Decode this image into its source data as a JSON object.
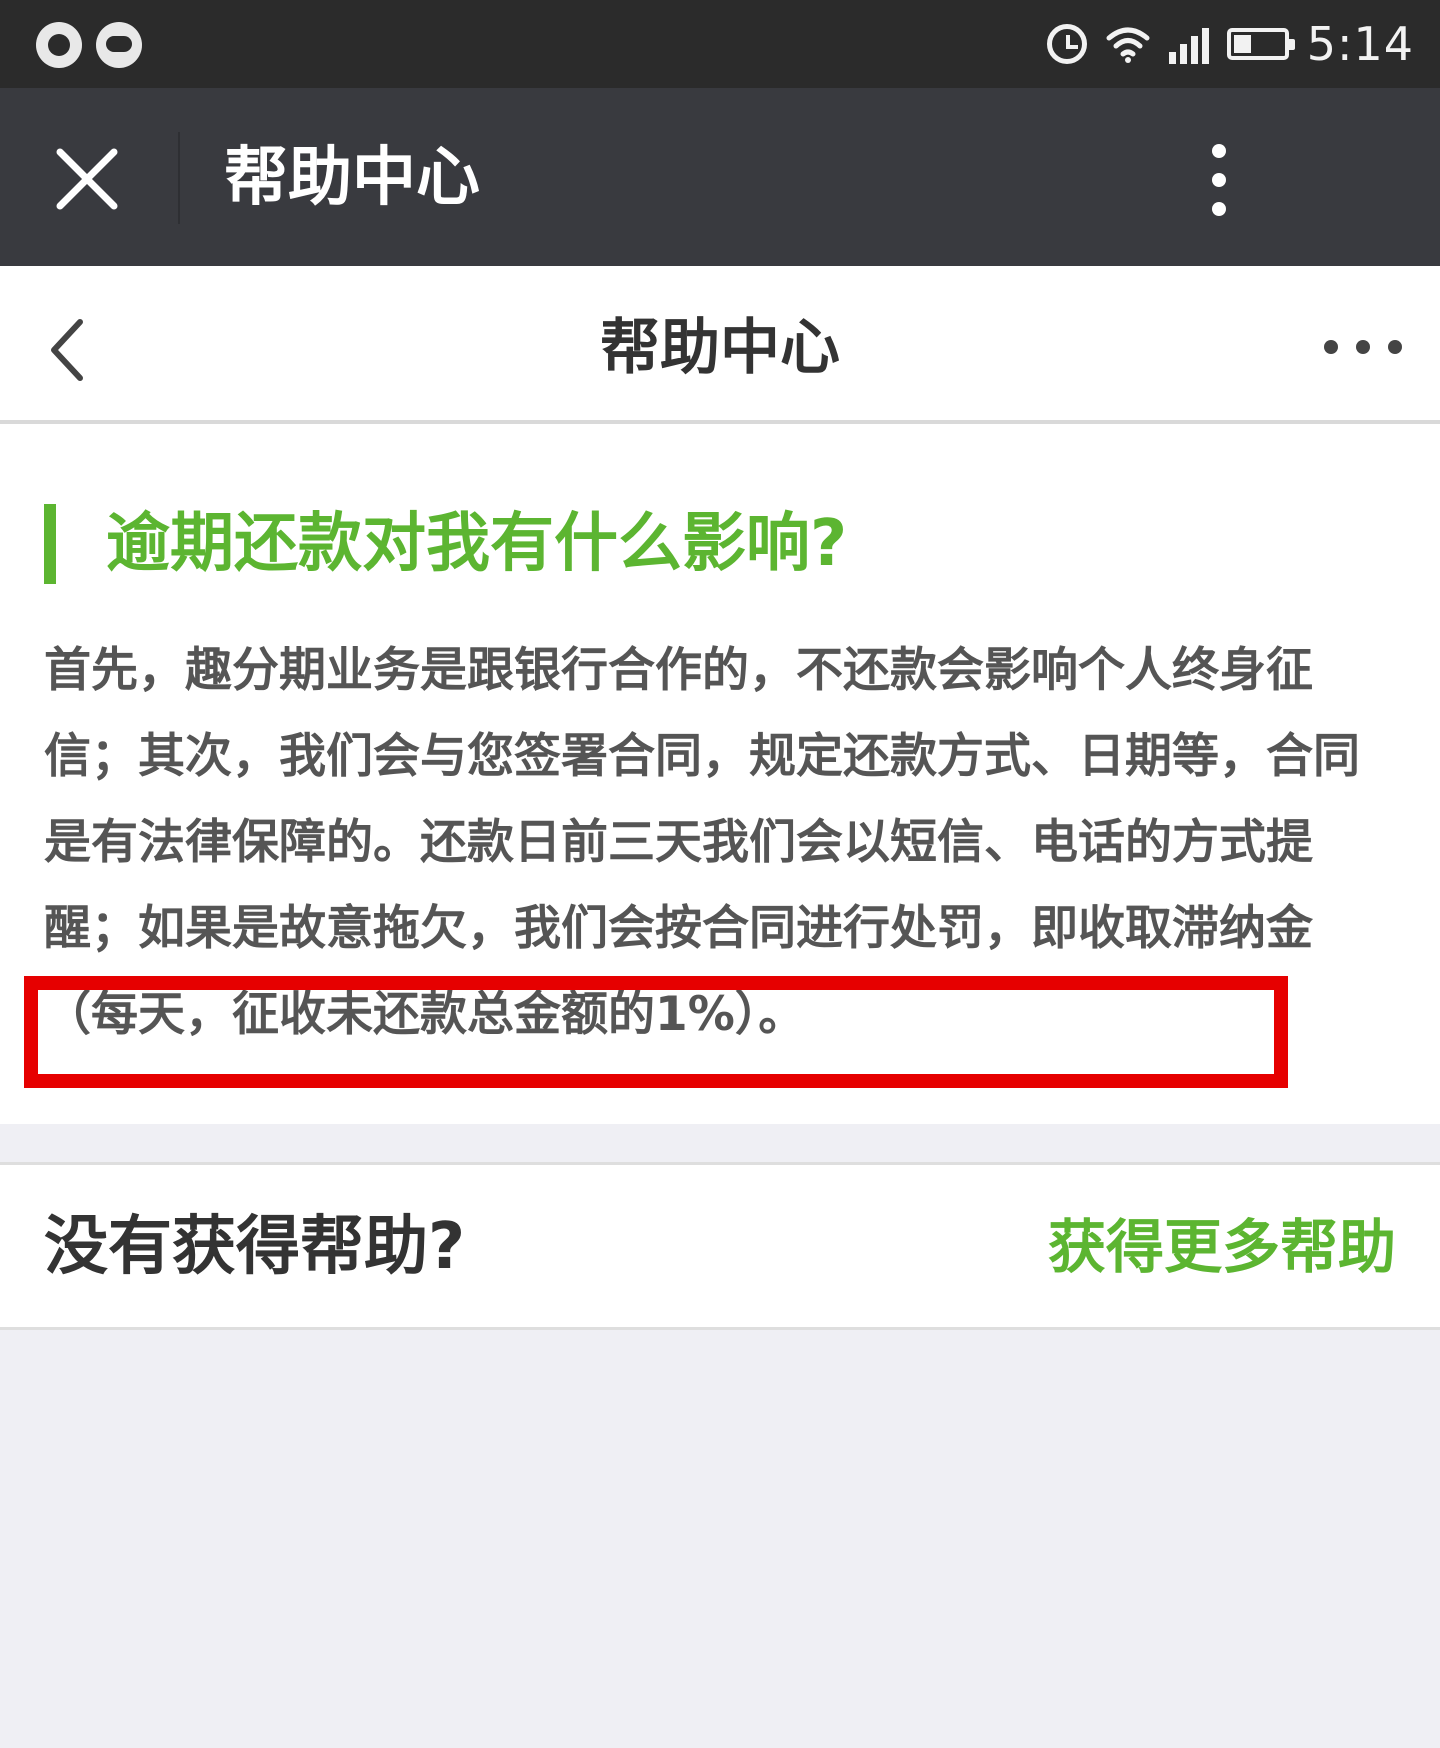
{
  "status_bar": {
    "time": "5:14",
    "battery_level": 0.35,
    "icons": [
      "notification-app-icon",
      "notification-app-icon",
      "alarm-icon",
      "wifi-icon",
      "signal-icon",
      "battery-icon"
    ]
  },
  "app_bar": {
    "title": "帮助中心",
    "close_icon": "close-icon",
    "menu_icon": "more-vertical-icon"
  },
  "nav_bar": {
    "title": "帮助中心",
    "back_icon": "chevron-left-icon",
    "more_icon": "more-horizontal-icon"
  },
  "article": {
    "question": "逾期还款对我有什么影响?",
    "answer": "首先，趣分期业务是跟银行合作的，不还款会影响个人终身征信；其次，我们会与您签署合同，规定还款方式、日期等，合同是有法律保障的。还款日前三天我们会以短信、电话的方式提醒；如果是故意拖欠，我们会按合同进行处罚，即收取滞纳金（每天，征收未还款总金额的1%）。"
  },
  "help": {
    "question": "没有获得帮助?",
    "link_label": "获得更多帮助"
  },
  "colors": {
    "accent_green": "#5cb531",
    "highlight_red": "#e60000",
    "app_bar": "#393a3f",
    "status_bar": "#2b2b2b"
  }
}
